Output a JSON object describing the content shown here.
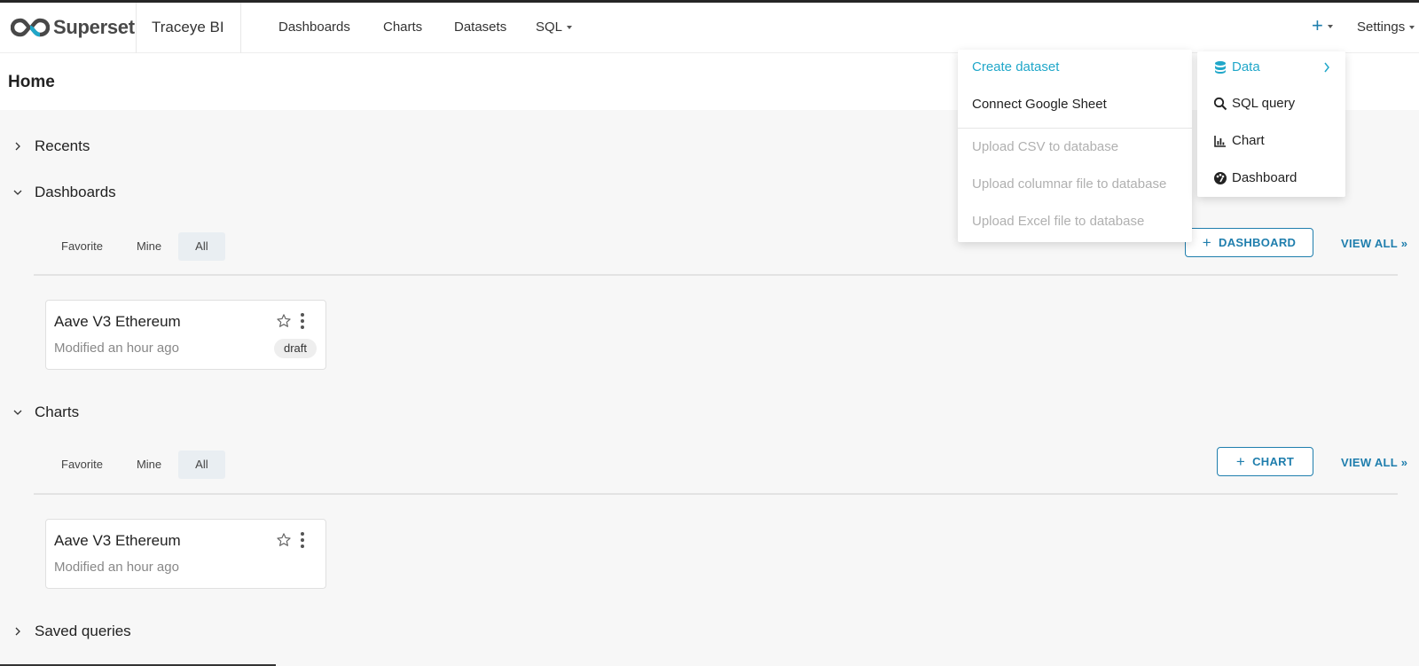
{
  "brand": {
    "name": "Superset",
    "app_name": "Traceye BI"
  },
  "nav": {
    "dashboards": "Dashboards",
    "charts": "Charts",
    "datasets": "Datasets",
    "sql": "SQL",
    "plus": "+",
    "settings": "Settings"
  },
  "page": {
    "title": "Home"
  },
  "sections": {
    "recents": "Recents",
    "dashboards": "Dashboards",
    "charts": "Charts",
    "saved_queries": "Saved queries"
  },
  "filter_tabs": [
    "Favorite",
    "Mine",
    "All"
  ],
  "dashboards": {
    "add_button": "DASHBOARD",
    "view_all": "VIEW ALL »",
    "cards": [
      {
        "title": "Aave V3 Ethereum",
        "modified": "Modified an hour ago",
        "badge": "draft"
      }
    ]
  },
  "charts": {
    "add_button": "CHART",
    "view_all": "VIEW ALL »",
    "cards": [
      {
        "title": "Aave V3 Ethereum",
        "modified": "Modified an hour ago"
      }
    ]
  },
  "plus_menu": {
    "items": [
      {
        "label": "Data",
        "icon": "database-icon"
      },
      {
        "label": "SQL query",
        "icon": "search-icon"
      },
      {
        "label": "Chart",
        "icon": "bar-chart-icon"
      },
      {
        "label": "Dashboard",
        "icon": "dashboard-icon"
      }
    ]
  },
  "data_submenu": {
    "create_dataset": "Create dataset",
    "connect_google_sheet": "Connect Google Sheet",
    "upload_csv": "Upload CSV to database",
    "upload_columnar": "Upload columnar file to database",
    "upload_excel": "Upload Excel file to database"
  },
  "colors": {
    "accent": "#1f7ead",
    "menu_active": "#20a7c9",
    "disabled": "#b0b0b0"
  }
}
